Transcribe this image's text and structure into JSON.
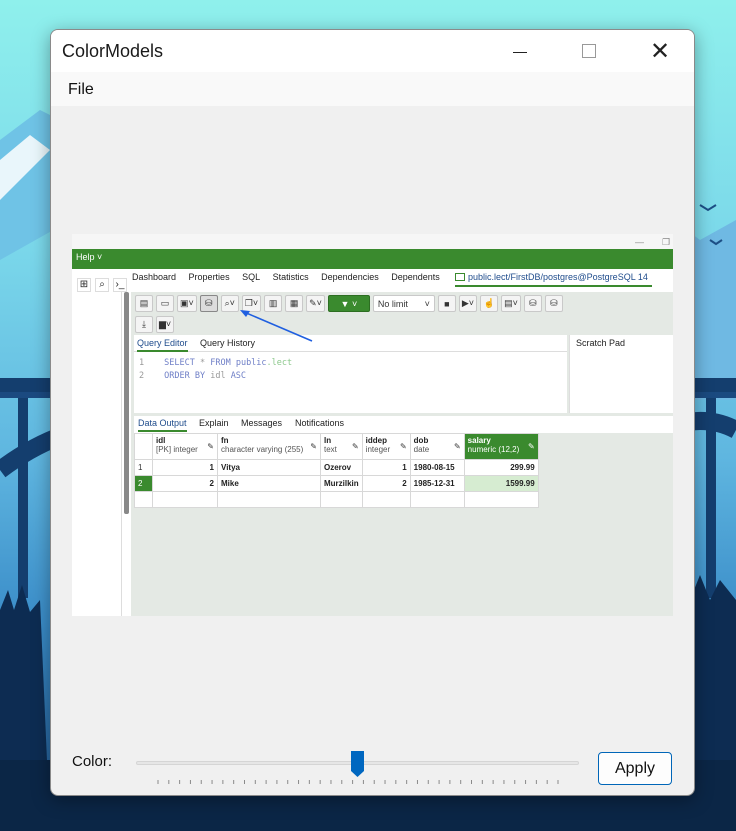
{
  "window": {
    "title": "ColorModels",
    "close_glyph": "✕"
  },
  "menu": {
    "file_label": "File"
  },
  "screenshot": {
    "help_menu": "Help ˅",
    "tabs": [
      "Dashboard",
      "Properties",
      "SQL",
      "Statistics",
      "Dependencies",
      "Dependents"
    ],
    "active_tab": "public.lect/FirstDB/postgres@PostgreSQL 14",
    "limit_select": "No limit",
    "editor_tabs": {
      "query_editor": "Query Editor",
      "query_history": "Query History",
      "scratch_pad": "Scratch Pad"
    },
    "code_lines": [
      {
        "num": "1",
        "kw1": "SELECT",
        "op": "*",
        "kw2": "FROM",
        "schema": "public",
        "table": ".lect"
      },
      {
        "num": "2",
        "kw1": "ORDER BY",
        "col": "idl",
        "kw2": "ASC"
      }
    ],
    "output_tabs": [
      "Data Output",
      "Explain",
      "Messages",
      "Notifications"
    ],
    "columns": [
      {
        "name": "idl",
        "type": "[PK] integer"
      },
      {
        "name": "fn",
        "type": "character varying (255)"
      },
      {
        "name": "ln",
        "type": "text"
      },
      {
        "name": "iddep",
        "type": "integer"
      },
      {
        "name": "dob",
        "type": "date"
      },
      {
        "name": "salary",
        "type": "numeric (12,2)"
      }
    ],
    "rows": [
      {
        "row": "1",
        "idl": "1",
        "fn": "Vitya",
        "ln": "Ozerov",
        "iddep": "1",
        "dob": "1980-08-15",
        "salary": "299.99"
      },
      {
        "row": "2",
        "idl": "2",
        "fn": "Mike",
        "ln": "Murzilkin",
        "iddep": "2",
        "dob": "1985-12-31",
        "salary": "1599.99"
      }
    ]
  },
  "controls": {
    "color_label": "Color:",
    "slider_value": 0.5,
    "apply_label": "Apply"
  },
  "colors": {
    "accent": "#0067c0",
    "pgadmin_green": "#3a8a2e"
  }
}
